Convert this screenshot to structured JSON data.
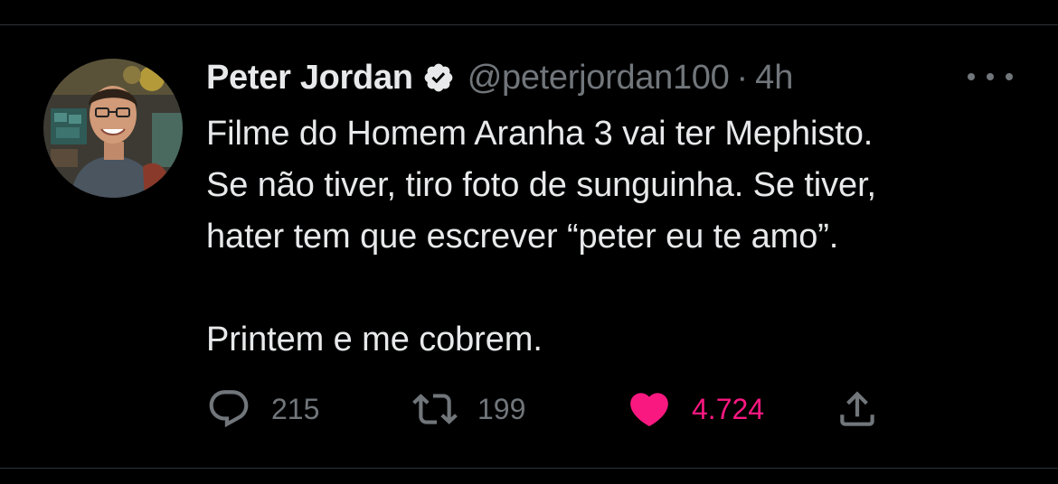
{
  "tweet": {
    "author": {
      "display_name": "Peter Jordan",
      "handle": "@peterjordan100",
      "verified": true
    },
    "separator": "·",
    "timestamp": "4h",
    "text_lines": [
      "Filme do Homem Aranha 3 vai ter Mephisto.",
      "Se não tiver, tiro foto de sunguinha. Se tiver,",
      "hater tem que escrever “peter eu te amo”."
    ],
    "text_last": "Printem e me cobrem.",
    "stats": {
      "replies": "215",
      "retweets": "199",
      "likes": "4.724"
    },
    "liked": true
  },
  "colors": {
    "background": "#000000",
    "text": "#e7e9ea",
    "secondary": "#71767b",
    "like": "#f91880",
    "divider": "#2f3336"
  },
  "icons": {
    "verified": "verified-badge-icon",
    "more": "more-dots-icon",
    "reply": "reply-icon",
    "retweet": "retweet-icon",
    "like": "heart-filled-icon",
    "share": "share-icon"
  }
}
